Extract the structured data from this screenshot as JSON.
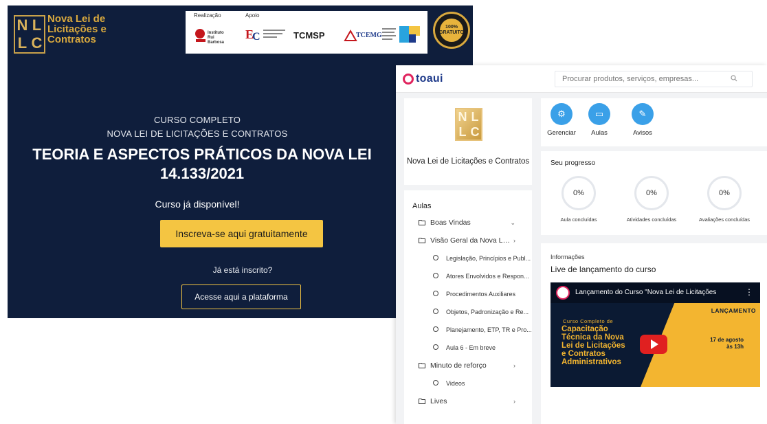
{
  "landing": {
    "brand_lines": [
      "Nova Lei de",
      "Licitações e",
      "Contratos"
    ],
    "logo_letters": [
      "N",
      "L",
      "L",
      "C"
    ],
    "partners": {
      "realizacao_label": "Realização",
      "apoio_label": "Apoio",
      "logo_irb": "Instituto Rui Barbosa",
      "logo_tcmsp": "TCMSP",
      "logo_tcemg": "TCEMG"
    },
    "badge_text": "100% GRATUITO",
    "subtitle_1": "CURSO COMPLETO",
    "subtitle_2": "NOVA LEI DE LICITAÇÕES E CONTRATOS",
    "headline": "TEORIA E ASPECTOS PRÁTICOS DA NOVA LEI 14.133/2021",
    "available": "Curso já disponível!",
    "cta_label": "Inscreva-se aqui gratuitamente",
    "already": "Já está inscrito?",
    "access_label": "Acesse aqui a plataforma"
  },
  "platform": {
    "app_name": "toaui",
    "search_placeholder": "Procurar produtos, serviços, empresas...",
    "course_title": "Nova Lei de Licitações e Contratos",
    "actions": [
      "Gerenciar",
      "Aulas",
      "Avisos"
    ],
    "aulas_heading": "Aulas",
    "lessons": [
      {
        "kind": "folder",
        "label": "Boas Vindas",
        "chevron": "down"
      },
      {
        "kind": "folder",
        "label": "Visão Geral da Nova Lei ...",
        "chevron": "right"
      },
      {
        "kind": "sub",
        "label": "Legislação, Princípios e Publ..."
      },
      {
        "kind": "sub",
        "label": "Atores Envolvidos e Respon..."
      },
      {
        "kind": "sub",
        "label": "Procedimentos Auxiliares"
      },
      {
        "kind": "sub",
        "label": "Objetos, Padronização e Re..."
      },
      {
        "kind": "sub",
        "label": "Planejamento, ETP, TR e Pro..."
      },
      {
        "kind": "sub",
        "label": "Aula 6 - Em breve"
      },
      {
        "kind": "folder",
        "label": "Minuto de reforço",
        "chevron": "right"
      },
      {
        "kind": "sub",
        "label": "Videos"
      },
      {
        "kind": "folder",
        "label": "Lives",
        "chevron": "right"
      }
    ],
    "progress_heading": "Seu progresso",
    "progress": [
      {
        "value": "0%",
        "label": "Aula concluídas"
      },
      {
        "value": "0%",
        "label": "Atividades concluídas"
      },
      {
        "value": "0%",
        "label": "Avaliações concluídas"
      }
    ],
    "info_heading": "Informações",
    "info_title": "Live de lançamento do curso",
    "video": {
      "title": "Lançamento do Curso \"Nova Lei de Licitações",
      "tag": "LANÇAMENTO",
      "kicker": "Curso Completo de",
      "headline_lines": [
        "Capacitação",
        "Técnica da Nova",
        "Lei de Licitações",
        "e Contratos",
        "Administrativos"
      ],
      "date_1": "17 de agosto",
      "date_2": "às 13h"
    }
  },
  "colors": {
    "navy": "#0f1e3c",
    "gold": "#f4c542",
    "accent_blue": "#3aa0e8",
    "brand_pink": "#e0245e"
  }
}
